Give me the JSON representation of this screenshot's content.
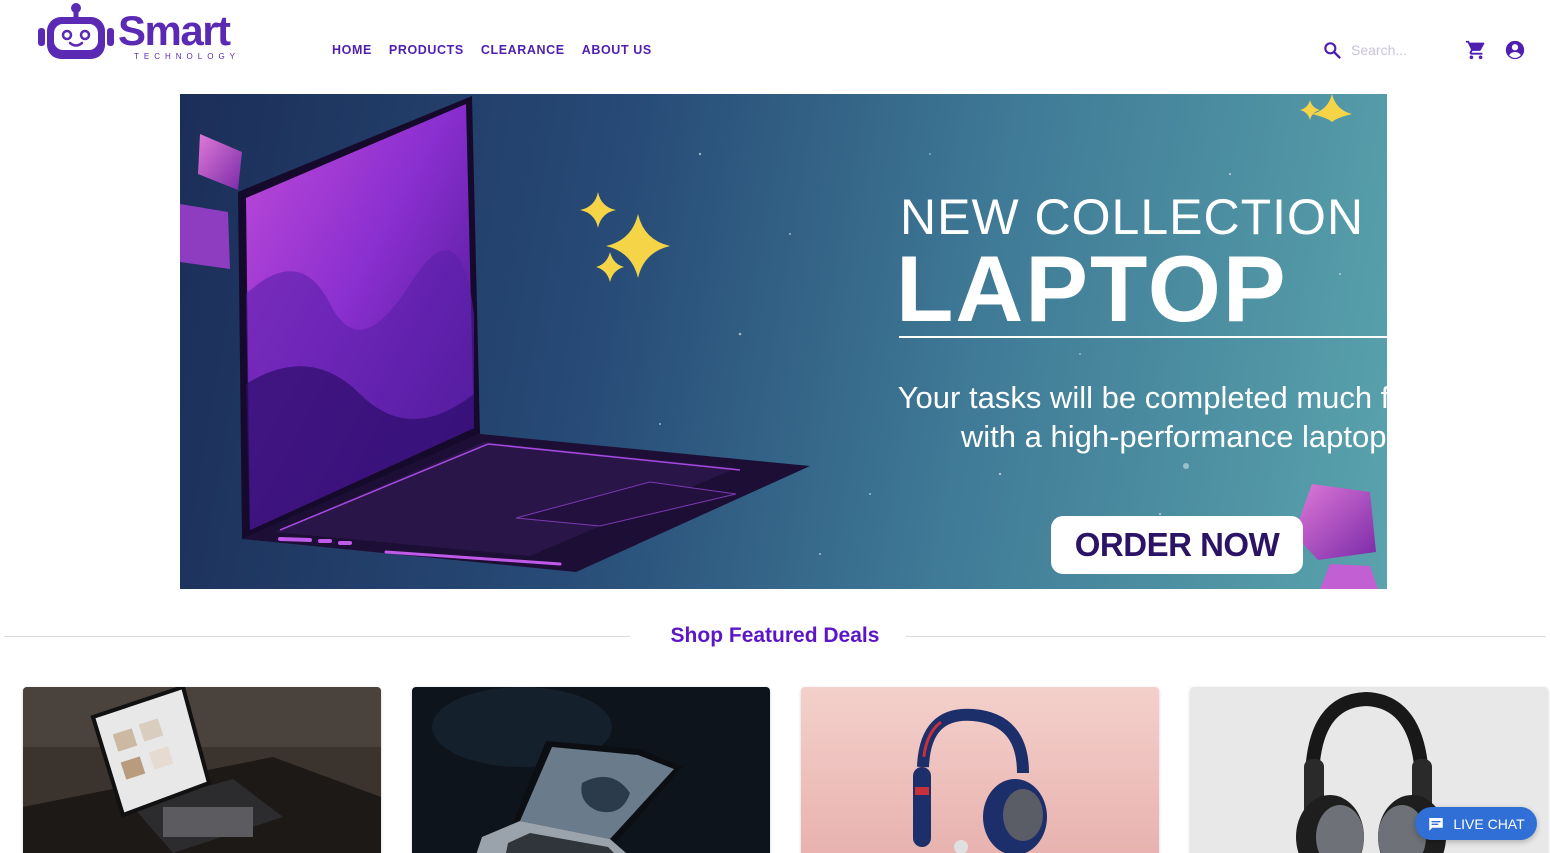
{
  "brand": {
    "name": "Smart",
    "tagline": "TECHNOLOGY",
    "color": "#5b2ab5"
  },
  "nav": {
    "items": [
      {
        "label": "HOME"
      },
      {
        "label": "PRODUCTS"
      },
      {
        "label": "CLEARANCE"
      },
      {
        "label": "ABOUT US"
      }
    ]
  },
  "search": {
    "placeholder": "Search...",
    "icon": "search-icon"
  },
  "header_icons": {
    "cart": "shopping-cart-icon",
    "account": "account-circle-icon"
  },
  "banner": {
    "headline": "NEW COLLECTION",
    "title": "LAPTOP",
    "subtitle_line1": "Your tasks will be completed much faster",
    "subtitle_line2": "with a high-performance laptop.",
    "cta_label": "ORDER NOW"
  },
  "featured": {
    "title": "Shop Featured Deals",
    "accent": "#5b16c8",
    "cards": [
      {
        "name": "tablet-keyboard",
        "background": "#3a332e"
      },
      {
        "name": "laptop-dark",
        "background": "#0d141c"
      },
      {
        "name": "headphones-blue-red",
        "background": "#f0c9c5"
      },
      {
        "name": "headphones-black",
        "background": "#e8e8e8"
      }
    ]
  },
  "live_chat": {
    "label": "LIVE CHAT",
    "color": "#2f6fd6",
    "icon": "chat-bubble-icon"
  }
}
